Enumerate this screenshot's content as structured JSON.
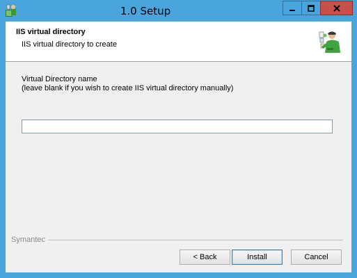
{
  "window": {
    "title": "1.0 Setup"
  },
  "header": {
    "title": "IIS virtual directory",
    "subtitle": "IIS virtual directory to create"
  },
  "form": {
    "label_line1": "Virtual Directory name",
    "label_line2": "(leave blank if you wish to  create IIS virtual directory manually)",
    "vdir_value": ""
  },
  "footer": {
    "brand": "Symantec"
  },
  "buttons": {
    "back": "< Back",
    "install": "Install",
    "cancel": "Cancel"
  },
  "colors": {
    "titlebar": "#4aa5dc",
    "close_button": "#c7504a",
    "dialog_bg": "#f0f0f0"
  },
  "icons": {
    "app": "setup-installer-icon",
    "header": "setup-wizard-person-icon"
  }
}
